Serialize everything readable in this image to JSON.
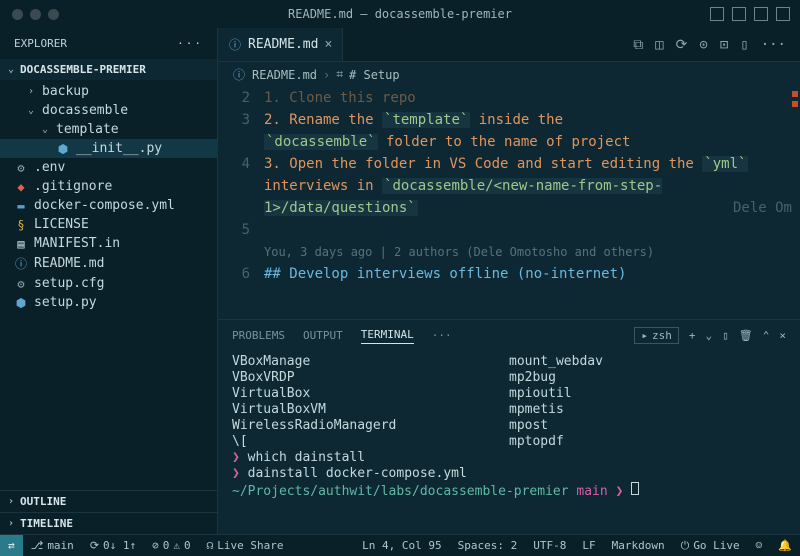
{
  "titlebar": {
    "title": "README.md — docassemble-premier"
  },
  "explorer": {
    "label": "EXPLORER"
  },
  "project": {
    "name": "DOCASSEMBLE-PREMIER"
  },
  "tree": {
    "backup": "backup",
    "docassemble": "docassemble",
    "template": "template",
    "init": "__init__.py",
    "env": ".env",
    "gitignore": ".gitignore",
    "compose": "docker-compose.yml",
    "license": "LICENSE",
    "manifest": "MANIFEST.in",
    "readme": "README.md",
    "setupcfg": "setup.cfg",
    "setuppy": "setup.py"
  },
  "outline": "OUTLINE",
  "timeline": "TIMELINE",
  "tab": {
    "name": "README.md"
  },
  "breadcrumb": {
    "file": "README.md",
    "section": "# Setup"
  },
  "code": {
    "l2": "1. Clone this repo",
    "l3a": "2. Rename the ",
    "l3b": "`template`",
    "l3c": " inside the ",
    "l3d": "`docassemble`",
    "l3e": " folder to the name of project",
    "l4a": "3. Open the folder in VS Code and start editing the ",
    "l4b": "`yml`",
    "l4c": " interviews in ",
    "l4d": "`docassemble/<new-name-from-step-1>/data/questions`",
    "ghost": "Dele Om",
    "blame": "You, 3 days ago | 2 authors (Dele Omotosho and others)",
    "l6": "## Develop interviews offline (no-internet)"
  },
  "panel": {
    "problems": "PROBLEMS",
    "output": "OUTPUT",
    "terminal": "TERMINAL",
    "shell": "zsh"
  },
  "term": {
    "col1": [
      "VBoxManage",
      "VBoxVRDP",
      "VirtualBox",
      "VirtualBoxVM",
      "WirelessRadioManagerd",
      "\\["
    ],
    "col2": [
      "mount_webdav",
      "mp2bug",
      "mpioutil",
      "mpmetis",
      "mpost",
      "mptopdf"
    ],
    "cmd1": "which dainstall",
    "cmd2": "dainstall docker-compose.yml",
    "path": "~/Projects/authwit/labs/docassemble-premier",
    "branch": "main"
  },
  "status": {
    "branch": "main",
    "sync": "0↓ 1↑",
    "errors": "0",
    "warnings": "0",
    "liveshare": "Live Share",
    "pos": "Ln 4, Col 95",
    "spaces": "Spaces: 2",
    "encoding": "UTF-8",
    "eol": "LF",
    "lang": "Markdown",
    "golive": "Go Live"
  }
}
